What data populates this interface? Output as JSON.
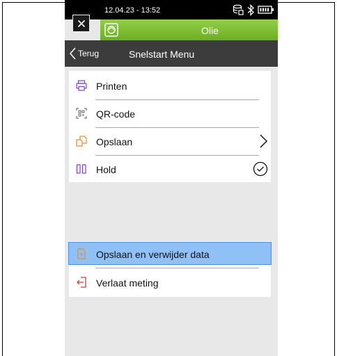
{
  "statusbar": {
    "time": "12.04.23 - 13:52"
  },
  "program": {
    "title": "Olie"
  },
  "header": {
    "back_label": "Terug",
    "title": "Snelstart Menu"
  },
  "menu": {
    "items": [
      {
        "label": "Printen",
        "icon": "printer-icon"
      },
      {
        "label": "QR-code",
        "icon": "qr-code-icon"
      },
      {
        "label": "Opslaan",
        "icon": "save-icon",
        "trailing": "chevron-right-icon"
      },
      {
        "label": "Hold",
        "icon": "hold-icon",
        "trailing": "check-circle-icon"
      }
    ]
  },
  "actions": {
    "items": [
      {
        "label": "Opslaan en verwijder data",
        "icon": "save-delete-icon",
        "selected": true
      },
      {
        "label": "Verlaat meting",
        "icon": "exit-icon"
      }
    ]
  },
  "colors": {
    "accent_green": "#7dbd33",
    "header": "#3c3c3c",
    "selection": "#8fc1f7",
    "icon_purple": "#7a3fd1",
    "icon_orange": "#f08a24",
    "icon_red": "#e0302b"
  }
}
